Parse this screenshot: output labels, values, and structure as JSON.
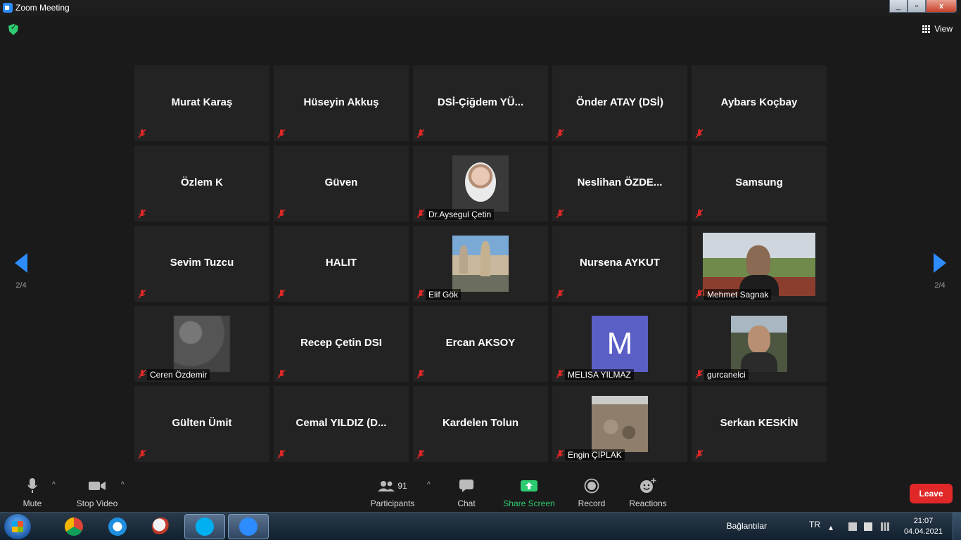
{
  "window": {
    "title": "Zoom Meeting",
    "minimize": "_",
    "maximize": "▫",
    "close": "x"
  },
  "top": {
    "view_label": "View"
  },
  "nav": {
    "page_indicator": "2/4"
  },
  "participants": [
    {
      "name": "Murat Karaş",
      "video": "none"
    },
    {
      "name": "Hüseyin Akkuş",
      "video": "none"
    },
    {
      "name": "DSİ-Çiğdem YÜ...",
      "video": "none"
    },
    {
      "name": "Önder ATAY (DSİ)",
      "video": "none"
    },
    {
      "name": "Aybars Koçbay",
      "video": "none"
    },
    {
      "name": "Özlem K",
      "video": "none"
    },
    {
      "name": "Güven",
      "video": "none"
    },
    {
      "name": "Dr.Aysegul Çetin",
      "video": "avatar-circle"
    },
    {
      "name": "Neslihan ÖZDE...",
      "video": "none"
    },
    {
      "name": "Samsung",
      "video": "none"
    },
    {
      "name": "Sevim Tuzcu",
      "video": "none"
    },
    {
      "name": "HALIT",
      "video": "none"
    },
    {
      "name": "Elif Gök",
      "video": "rocks"
    },
    {
      "name": "Nursena AYKUT",
      "video": "none"
    },
    {
      "name": "Mehmet Sagnak",
      "video": "outdoor-wide"
    },
    {
      "name": "Ceren Özdemir",
      "video": "blurred"
    },
    {
      "name": "Recep Çetin DSI",
      "video": "none"
    },
    {
      "name": "Ercan AKSOY",
      "video": "none"
    },
    {
      "name": "MELISA YILMAZ",
      "video": "letter-m",
      "avatar_letter": "M"
    },
    {
      "name": "gurcanelci",
      "video": "outdoor-man"
    },
    {
      "name": "Gülten Ümit",
      "video": "none"
    },
    {
      "name": "Cemal YILDIZ (D...",
      "video": "none"
    },
    {
      "name": "Kardelen Tolun",
      "video": "none"
    },
    {
      "name": "Engin ÇIPLAK",
      "video": "rocky-field"
    },
    {
      "name": "Serkan KESKİN",
      "video": "none"
    }
  ],
  "toolbar": {
    "mute": "Mute",
    "stop_video": "Stop Video",
    "participants": "Participants",
    "participants_count": "91",
    "chat": "Chat",
    "share_screen": "Share Screen",
    "record": "Record",
    "reactions": "Reactions",
    "leave": "Leave"
  },
  "taskbar": {
    "connections": "Bağlantılar",
    "language": "TR",
    "time": "21:07",
    "date": "04.04.2021"
  },
  "colors": {
    "accent": "#2d8cff",
    "share": "#2ecc71",
    "leave": "#e02828",
    "mute_icon": "#e02828"
  }
}
